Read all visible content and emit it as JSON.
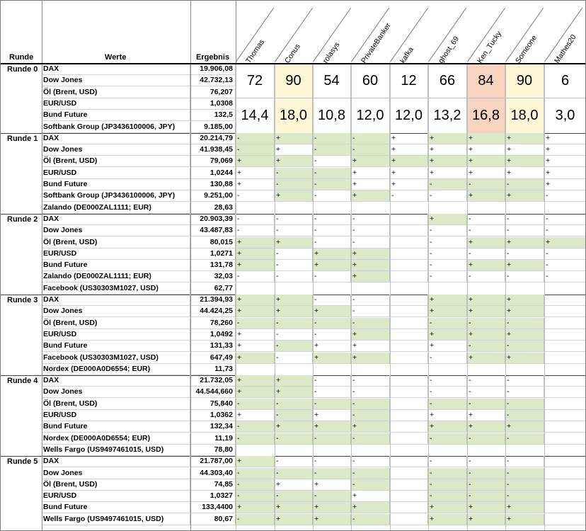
{
  "headers": {
    "runde": "Runde",
    "werte": "Werte",
    "ergebnis": "Ergebnis"
  },
  "players": [
    "Thomas",
    "Conus",
    "rolasys",
    "PrivateBanker",
    "kafka",
    "ghost_69",
    "Ken_Tucky",
    "Someone",
    "Mathes20"
  ],
  "colors": {
    "green": "#dce8c8",
    "yellow": "#fef7d5",
    "orange": "#f8d3bf"
  },
  "round0": {
    "label": "Runde 0",
    "rows": [
      {
        "name": "DAX",
        "value": "19.906,08"
      },
      {
        "name": "Dow Jones",
        "value": "42.732,13"
      },
      {
        "name": "Öl (Brent, USD)",
        "value": "76,207"
      },
      {
        "name": "EUR/USD",
        "value": "1,0308"
      },
      {
        "name": "Bund Future",
        "value": "132,5"
      },
      {
        "name": "Softbank Group (JP3436100006, JPY)",
        "value": "9.185,00"
      }
    ],
    "scores": [
      "72",
      "90",
      "54",
      "60",
      "12",
      "66",
      "84",
      "90",
      "6"
    ],
    "averages": [
      "14,4",
      "18,0",
      "10,8",
      "12,0",
      "12,0",
      "13,2",
      "16,8",
      "18,0",
      "3,0"
    ],
    "highlight": [
      "",
      "yellow",
      "",
      "",
      "",
      "",
      "orange",
      "yellow",
      ""
    ]
  },
  "rounds": [
    {
      "label": "Runde 1",
      "rows": [
        {
          "name": "DAX",
          "value": "20.214,79",
          "cells": [
            "-",
            "+",
            "-",
            "-",
            "+",
            "+",
            "+",
            "+",
            "+"
          ],
          "green": [
            1,
            1,
            1,
            1,
            0,
            1,
            1,
            1,
            0
          ]
        },
        {
          "name": "Dow Jones",
          "value": "41.938,45",
          "cells": [
            "-",
            "+",
            "-",
            "-",
            "+",
            "+",
            "+",
            "+",
            "+"
          ],
          "green": [
            1,
            0,
            1,
            1,
            0,
            0,
            0,
            0,
            0
          ]
        },
        {
          "name": "Öl (Brent, USD)",
          "value": "79,069",
          "cells": [
            "+",
            "+",
            "-",
            "+",
            "+",
            "+",
            "+",
            "+",
            "+"
          ],
          "green": [
            1,
            1,
            0,
            1,
            1,
            1,
            1,
            1,
            0
          ]
        },
        {
          "name": "EUR/USD",
          "value": "1,0244",
          "cells": [
            "+",
            "-",
            "-",
            "+",
            "+",
            "+",
            "+",
            "+",
            "+"
          ],
          "green": [
            0,
            1,
            1,
            0,
            0,
            0,
            0,
            0,
            0
          ]
        },
        {
          "name": "Bund Future",
          "value": "130,88",
          "cells": [
            "+",
            "-",
            "-",
            "+",
            "+",
            "-",
            "-",
            "-",
            "+"
          ],
          "green": [
            0,
            1,
            1,
            0,
            0,
            1,
            1,
            1,
            0
          ]
        },
        {
          "name": "Softbank Group (JP3436100006, JPY)",
          "value": "9.251,00",
          "cells": [
            "-",
            "+",
            "-",
            "+",
            "-",
            "-",
            "+",
            "+",
            "-"
          ],
          "green": [
            0,
            1,
            0,
            1,
            0,
            0,
            1,
            1,
            0
          ]
        },
        {
          "name": "Zalando (DE000ZAL1111; EUR)",
          "value": "28,63",
          "cells": null,
          "green": null
        }
      ]
    },
    {
      "label": "Runde 2",
      "rows": [
        {
          "name": "DAX",
          "value": "20.903,39",
          "cells": [
            "-",
            "-",
            "-",
            "-",
            "",
            "+",
            "-",
            "-",
            "-"
          ],
          "green": [
            0,
            0,
            0,
            0,
            0,
            1,
            0,
            0,
            0
          ]
        },
        {
          "name": "Dow Jones",
          "value": "43.487,83",
          "cells": [
            "-",
            "-",
            "-",
            "-",
            "",
            "-",
            "-",
            "-",
            "-"
          ],
          "green": [
            0,
            0,
            0,
            0,
            0,
            0,
            0,
            0,
            0
          ]
        },
        {
          "name": "Öl (Brent, USD)",
          "value": "80,015",
          "cells": [
            "+",
            "+",
            "-",
            "-",
            "",
            "-",
            "+",
            "+",
            "+"
          ],
          "green": [
            1,
            1,
            0,
            0,
            0,
            0,
            1,
            1,
            1
          ]
        },
        {
          "name": "EUR/USD",
          "value": "1,0271",
          "cells": [
            "+",
            "-",
            "+",
            "+",
            "",
            "-",
            "-",
            "-",
            "-"
          ],
          "green": [
            1,
            0,
            1,
            1,
            0,
            0,
            0,
            0,
            0
          ]
        },
        {
          "name": "Bund Future",
          "value": "131,78",
          "cells": [
            "+",
            "-",
            "+",
            "+",
            "",
            "-",
            "+",
            "+",
            "-"
          ],
          "green": [
            1,
            0,
            1,
            1,
            0,
            0,
            1,
            1,
            0
          ]
        },
        {
          "name": "Zalando (DE000ZAL1111; EUR)",
          "value": "32,03",
          "cells": [
            "-",
            "-",
            "-",
            "+",
            "",
            "-",
            "-",
            "-",
            "-"
          ],
          "green": [
            0,
            0,
            0,
            1,
            0,
            0,
            0,
            0,
            0
          ]
        },
        {
          "name": "Facebook (US30303M1027, USD)",
          "value": "62,77",
          "cells": null,
          "green": null
        }
      ]
    },
    {
      "label": "Runde 3",
      "rows": [
        {
          "name": "DAX",
          "value": "21.394,93",
          "cells": [
            "+",
            "+",
            "-",
            "-",
            "",
            "+",
            "+",
            "+",
            ""
          ],
          "green": [
            1,
            1,
            0,
            0,
            0,
            1,
            1,
            1,
            0
          ]
        },
        {
          "name": "Dow Jones",
          "value": "44.424,25",
          "cells": [
            "+",
            "+",
            "+",
            "-",
            "",
            "+",
            "+",
            "+",
            ""
          ],
          "green": [
            1,
            1,
            1,
            0,
            0,
            1,
            1,
            1,
            0
          ]
        },
        {
          "name": "Öl (Brent, USD)",
          "value": "78,260",
          "cells": [
            "-",
            "-",
            "-",
            "-",
            "",
            "-",
            "-",
            "-",
            ""
          ],
          "green": [
            1,
            1,
            1,
            1,
            0,
            1,
            1,
            1,
            0
          ]
        },
        {
          "name": "EUR/USD",
          "value": "1,0492",
          "cells": [
            "+",
            "-",
            "-",
            "+",
            "",
            "+",
            "+",
            "+",
            ""
          ],
          "green": [
            0,
            0,
            0,
            1,
            0,
            1,
            1,
            1,
            0
          ]
        },
        {
          "name": "Bund Future",
          "value": "131,33",
          "cells": [
            "+",
            "-",
            "+",
            "+",
            "",
            "+",
            "-",
            "-",
            ""
          ],
          "green": [
            0,
            1,
            0,
            0,
            0,
            0,
            1,
            1,
            0
          ]
        },
        {
          "name": "Facebook (US30303M1027, USD)",
          "value": "647,49",
          "cells": [
            "+",
            "-",
            "+",
            "+",
            "",
            "-",
            "+",
            "+",
            ""
          ],
          "green": [
            1,
            0,
            1,
            1,
            0,
            0,
            1,
            1,
            0
          ]
        },
        {
          "name": "Nordex (DE000A0D6554; EUR)",
          "value": "11,73",
          "cells": null,
          "green": null
        }
      ]
    },
    {
      "label": "Runde 4",
      "rows": [
        {
          "name": "DAX",
          "value": "21.732,05",
          "cells": [
            "+",
            "+",
            "-",
            "-",
            "",
            "-",
            "-",
            "-",
            ""
          ],
          "green": [
            1,
            1,
            0,
            0,
            0,
            0,
            0,
            0,
            0
          ]
        },
        {
          "name": "Dow Jones",
          "value": "44.544,660",
          "cells": [
            "+",
            "+",
            "-",
            "-",
            "",
            "-",
            "-",
            "-",
            ""
          ],
          "green": [
            1,
            1,
            0,
            0,
            0,
            0,
            0,
            0,
            0
          ]
        },
        {
          "name": "Öl (Brent, USD)",
          "value": "75,840",
          "cells": [
            "-",
            "-",
            "-",
            "-",
            "",
            "-",
            "-",
            "-",
            ""
          ],
          "green": [
            1,
            1,
            1,
            1,
            0,
            1,
            1,
            1,
            0
          ]
        },
        {
          "name": "EUR/USD",
          "value": "1,0362",
          "cells": [
            "+",
            "-",
            "+",
            "-",
            "",
            "+",
            "+",
            "-",
            ""
          ],
          "green": [
            0,
            1,
            0,
            1,
            0,
            0,
            0,
            1,
            0
          ]
        },
        {
          "name": "Bund Future",
          "value": "132,34",
          "cells": [
            "-",
            "+",
            "+",
            "+",
            "",
            "+",
            "+",
            "+",
            ""
          ],
          "green": [
            1,
            1,
            1,
            1,
            0,
            1,
            1,
            1,
            0
          ]
        },
        {
          "name": "Nordex (DE000A0D6554; EUR)",
          "value": "11,19",
          "cells": [
            "-",
            "-",
            "-",
            "-",
            "",
            "-",
            "-",
            "-",
            ""
          ],
          "green": [
            1,
            1,
            1,
            1,
            0,
            1,
            1,
            1,
            0
          ]
        },
        {
          "name": "Wells Fargo (US9497461015, USD)",
          "value": "78,80",
          "cells": null,
          "green": null
        }
      ]
    },
    {
      "label": "Runde 5",
      "rows": [
        {
          "name": "DAX",
          "value": "21.787,00",
          "cells": [
            "+",
            "-",
            "-",
            "-",
            "",
            "-",
            "-",
            "-",
            ""
          ],
          "green": [
            1,
            0,
            0,
            0,
            0,
            0,
            0,
            0,
            0
          ]
        },
        {
          "name": "Dow Jones",
          "value": "44.303,40",
          "cells": [
            "-",
            "-",
            "-",
            "-",
            "",
            "-",
            "-",
            "-",
            ""
          ],
          "green": [
            1,
            1,
            1,
            1,
            0,
            1,
            1,
            1,
            0
          ]
        },
        {
          "name": "Öl (Brent, USD)",
          "value": "74,85",
          "cells": [
            "-",
            "+",
            "+",
            "-",
            "",
            "-",
            "-",
            "-",
            ""
          ],
          "green": [
            1,
            0,
            0,
            1,
            0,
            1,
            1,
            1,
            0
          ]
        },
        {
          "name": "EUR/USD",
          "value": "1,0327",
          "cells": [
            "-",
            "-",
            "-",
            "+",
            "",
            "-",
            "-",
            "-",
            ""
          ],
          "green": [
            1,
            1,
            1,
            0,
            0,
            1,
            1,
            1,
            0
          ]
        },
        {
          "name": "Bund Future",
          "value": "133,4400",
          "cells": [
            "+",
            "+",
            "+",
            "+",
            "",
            "+",
            "+",
            "+",
            ""
          ],
          "green": [
            1,
            1,
            1,
            1,
            0,
            1,
            1,
            1,
            0
          ]
        },
        {
          "name": "Wells Fargo (US9497461015, USD)",
          "value": "80,67",
          "cells": [
            "-",
            "+",
            "+",
            "-",
            "",
            "+",
            "+",
            "+",
            ""
          ],
          "green": [
            1,
            1,
            1,
            1,
            0,
            1,
            1,
            1,
            0
          ]
        }
      ]
    }
  ]
}
